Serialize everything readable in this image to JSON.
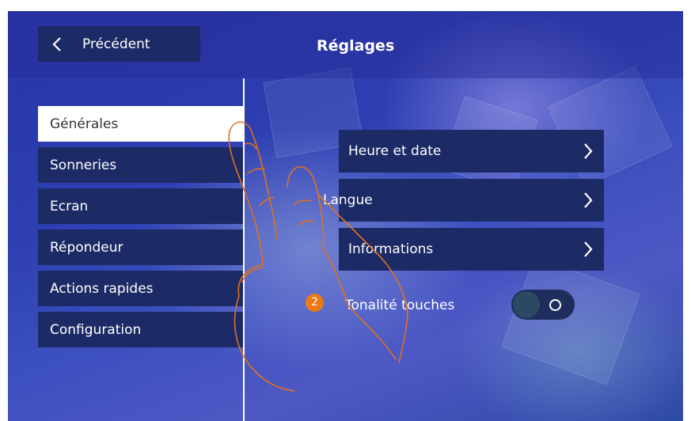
{
  "header": {
    "back_label": "Précédent",
    "title": "Réglages"
  },
  "menu": {
    "items": [
      {
        "label": "Générales",
        "active": true
      },
      {
        "label": "Sonneries",
        "active": false
      },
      {
        "label": "Ecran",
        "active": false
      },
      {
        "label": "Répondeur",
        "active": false
      },
      {
        "label": "Actions rapides",
        "active": false
      },
      {
        "label": "Configuration",
        "active": false
      }
    ]
  },
  "settings": {
    "rows": [
      {
        "label": "Heure et date"
      },
      {
        "label": "Langue"
      },
      {
        "label": "Informations"
      }
    ],
    "toggle": {
      "label": "Tonalité touches",
      "state": "off"
    }
  },
  "annotation": {
    "step_number": "2"
  },
  "colors": {
    "button_bg": "#1c2a66",
    "active_item_bg": "#ffffff",
    "badge": "#ea7a12",
    "hand_outline": "#e07020"
  },
  "icons": [
    "chevron-left-icon",
    "chevron-right-icon",
    "finger-hand-icon"
  ]
}
